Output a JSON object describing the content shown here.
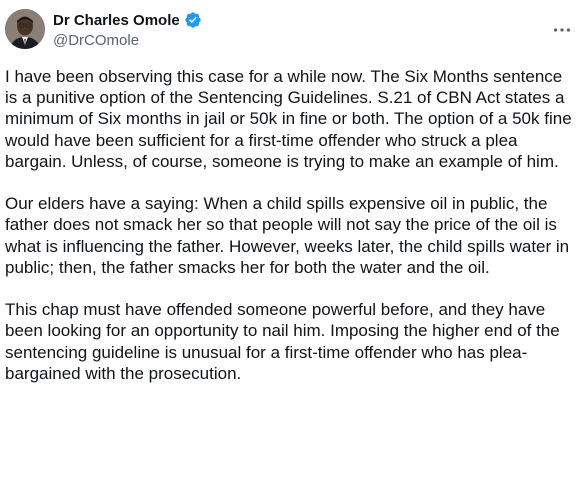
{
  "author": {
    "display_name": "Dr Charles Omole",
    "handle": "@DrCOmole",
    "verified": true,
    "avatar_icon": "profile-photo"
  },
  "menu_icon": "more-horizontal-icon",
  "colors": {
    "verified_badge": "#1d9bf0",
    "text_primary": "#0f1419",
    "text_secondary": "#536471"
  },
  "tweet": {
    "paragraphs": [
      "I have been observing this case for a while now. The Six Months sentence is a punitive option of the Sentencing Guidelines. S.21 of CBN Act states a minimum of Six months in jail or 50k in fine or both. The option of a 50k fine would have been sufficient for a first-time offender who struck a plea bargain. Unless, of course, someone is trying to make an example of him.",
      "Our elders have a saying: When a child spills expensive oil in public, the father does not smack her so that people will not say the price of the oil is what is influencing the father. However, weeks later, the child spills water in public; then, the father smacks her for both the water and the oil.",
      "This chap must have offended someone powerful before, and they have been looking for an opportunity to nail him. Imposing the higher end of the sentencing guideline is unusual for a first-time offender who has plea-bargained with the prosecution."
    ]
  }
}
